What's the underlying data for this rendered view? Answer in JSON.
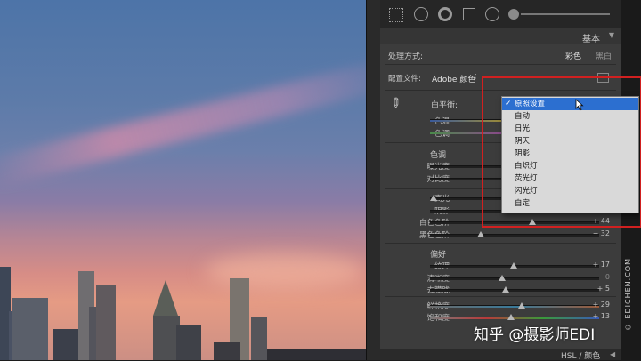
{
  "panel": {
    "section_title": "基本",
    "treatment_label": "处理方式:",
    "treatment_color": "彩色",
    "treatment_bw": "黑白",
    "profile_label": "配置文件:",
    "profile_value": "Adobe 颜色",
    "wb_label": "白平衡:",
    "temp_label": "色温",
    "tint_label": "色调",
    "tone_head": "色调",
    "exposure_label": "曝光度",
    "contrast_label": "对比度",
    "highlights_label": "高光",
    "shadows_label": "阴影",
    "whites_label": "白色色阶",
    "whites_value": "+ 44",
    "blacks_label": "黑色色阶",
    "blacks_value": "− 32",
    "presence_head": "偏好",
    "texture_label": "纹理",
    "texture_value": "+ 17",
    "clarity_label": "清晰度",
    "clarity_value": "0",
    "dehaze_label": "去朦胧",
    "dehaze_value": "+ 5",
    "vibrance_label": "鲜艳度",
    "vibrance_value": "+ 29",
    "saturation_label": "饱和度",
    "saturation_value": "+ 13",
    "bottom_section": "HSL / 颜色"
  },
  "wb_dropdown": {
    "check": "✓",
    "items": [
      "原照设置",
      "自动",
      "日光",
      "阴天",
      "阴影",
      "白炽灯",
      "荧光灯",
      "闪光灯",
      "自定"
    ]
  },
  "side_label": "© EDICHEN.COM",
  "watermark": "知乎 @摄影师EDI",
  "colors": {
    "highlight": "#2c6fd0",
    "annotation": "#d12020",
    "panel_bg": "#3c3c3c"
  }
}
